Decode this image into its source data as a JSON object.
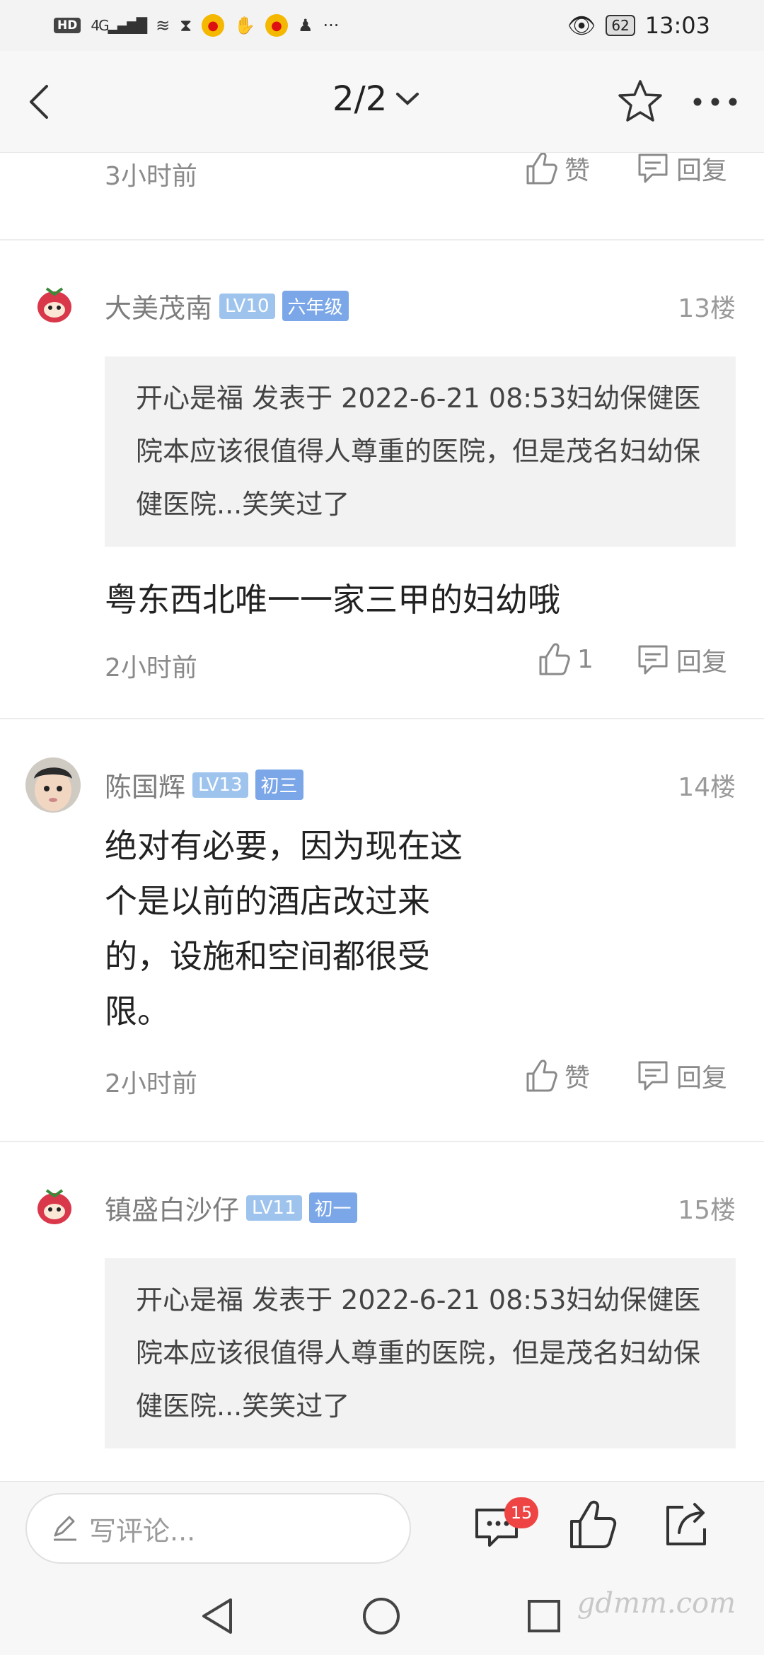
{
  "status_bar": {
    "hd": "HD",
    "signal": "4G",
    "battery": "62",
    "time": "13:03",
    "more": "···"
  },
  "header": {
    "page_indicator": "2/2"
  },
  "top_stub": {
    "time": "3小时前",
    "like_label": "赞",
    "reply_label": "回复"
  },
  "floors": [
    {
      "username": "大美茂南",
      "level": "LV10",
      "grade": "六年级",
      "floor": "13楼",
      "quote": "开心是福 发表于 2022-6-21 08:53妇幼保健医院本应该很值得人尊重的医院，但是茂名妇幼保健医院...笑笑过了",
      "body": "粤东西北唯一一家三甲的妇幼哦",
      "time": "2小时前",
      "like_label": "1",
      "reply_label": "回复"
    },
    {
      "username": "陈国辉",
      "level": "LV13",
      "grade": "初三",
      "floor": "14楼",
      "body": "绝对有必要，因为现在这个是以前的酒店改过来的，设施和空间都很受限。",
      "time": "2小时前",
      "like_label": "赞",
      "reply_label": "回复"
    },
    {
      "username": "镇盛白沙仔",
      "level": "LV11",
      "grade": "初一",
      "floor": "15楼",
      "quote": "开心是福 发表于 2022-6-21 08:53妇幼保健医院本应该很值得人尊重的医院，但是茂名妇幼保健医院...笑笑过了"
    }
  ],
  "bottom_bar": {
    "comment_placeholder": "写评论...",
    "comment_count": "15"
  },
  "watermark": "gdmm.com",
  "colors": {
    "accent_badge": "#ee4444",
    "level_tag": "#9ec4ee",
    "grade_tag": "#7ba7e8"
  }
}
